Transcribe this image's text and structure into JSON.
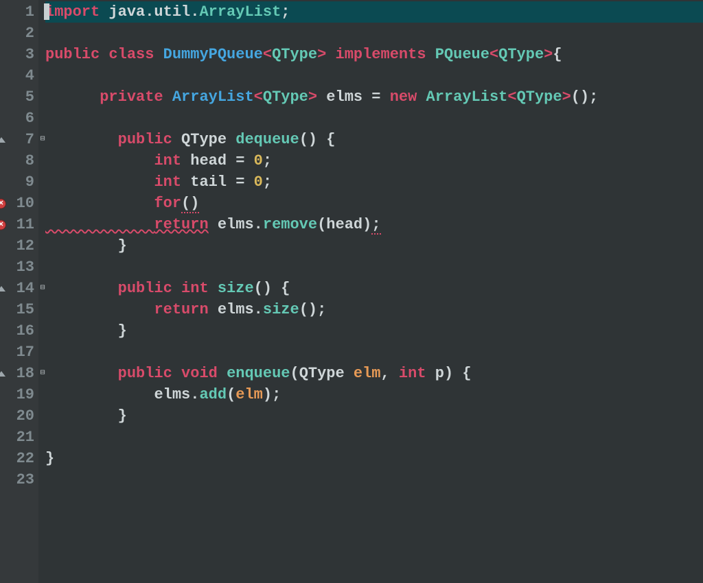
{
  "gutter": {
    "lines": [
      "1",
      "2",
      "3",
      "4",
      "5",
      "6",
      "7",
      "8",
      "9",
      "10",
      "11",
      "12",
      "13",
      "14",
      "15",
      "16",
      "17",
      "18",
      "19",
      "20",
      "21",
      "22",
      "23"
    ],
    "errors": [
      10,
      11
    ],
    "warn_arrows": [
      7,
      14,
      18
    ],
    "fold_open": [
      7
    ],
    "fold_closed": [
      14,
      18
    ]
  },
  "icons": {
    "error": "error-marker",
    "warn": "warning-arrow",
    "fold_open": "fold-open-icon",
    "fold_closed": "fold-closed-icon"
  },
  "code": {
    "l1": {
      "kw_import": "import",
      "sp": " ",
      "pkg": "java.util.",
      "cls": "ArrayList",
      "semi": ";"
    },
    "l3": {
      "kw_public": "public",
      "kw_class": "class",
      "cls": "DummyPQueue",
      "lt": "<",
      "gt1": ">",
      "gen": "QType",
      "kw_impl": "implements",
      "iface": "PQueue",
      "lt2": "<",
      "gen2": "QType",
      "gt2": ">",
      "brace": "{"
    },
    "l5": {
      "indent": "      ",
      "kw_private": "private",
      "type": "ArrayList",
      "lt": "<",
      "gen": "QType",
      "gt": ">",
      "name": "elms",
      "eq": " = ",
      "kw_new": "new",
      "type2": "ArrayList",
      "lt2": "<",
      "gen2": "QType",
      "gt2": ">",
      "call": "();"
    },
    "l7": {
      "indent": "        ",
      "kw_public": "public",
      "ret": "QType",
      "name": "dequeue",
      "paren": "() {"
    },
    "l8": {
      "indent": "            ",
      "kw_int": "int",
      "name": "head",
      "eq": " = ",
      "val": "0",
      "semi": ";"
    },
    "l9": {
      "indent": "            ",
      "kw_int": "int",
      "name": "tail",
      "eq": " = ",
      "val": "0",
      "semi": ";"
    },
    "l10": {
      "indent": "            ",
      "kw_for": "for",
      "paren": "()"
    },
    "l11": {
      "indent": "            ",
      "kw_return": "return",
      "expr": " elms.",
      "call": "remove",
      "args": "(head)",
      "semi": ";"
    },
    "l12": {
      "indent": "        ",
      "brace": "}"
    },
    "l14": {
      "indent": "        ",
      "kw_public": "public",
      "kw_int": "int",
      "name": "size",
      "paren": "() {"
    },
    "l15": {
      "indent": "            ",
      "kw_return": "return",
      "expr": " elms.",
      "call": "size",
      "paren2": "();"
    },
    "l16": {
      "indent": "        ",
      "brace": "}"
    },
    "l18": {
      "indent": "        ",
      "kw_public": "public",
      "kw_void": "void",
      "name": "enqueue",
      "lp": "(",
      "ptype": "QType",
      "p1": "elm",
      "comma": ", ",
      "kw_int": "int",
      "p2": "p",
      "rp": ") {"
    },
    "l19": {
      "indent": "            ",
      "obj": "elms.",
      "call": "add",
      "lp": "(",
      "arg": "elm",
      "rp": ");"
    },
    "l20": {
      "indent": "        ",
      "brace": "}"
    },
    "l22": {
      "brace": "}"
    }
  },
  "colors": {
    "keyword": "#d84b6a",
    "type": "#45a6e0",
    "function": "#64c9b5",
    "number": "#d9b85a",
    "param": "#e79a56",
    "background": "#2f3436",
    "gutter_bg": "#35393b",
    "selection": "#0b4a52"
  }
}
